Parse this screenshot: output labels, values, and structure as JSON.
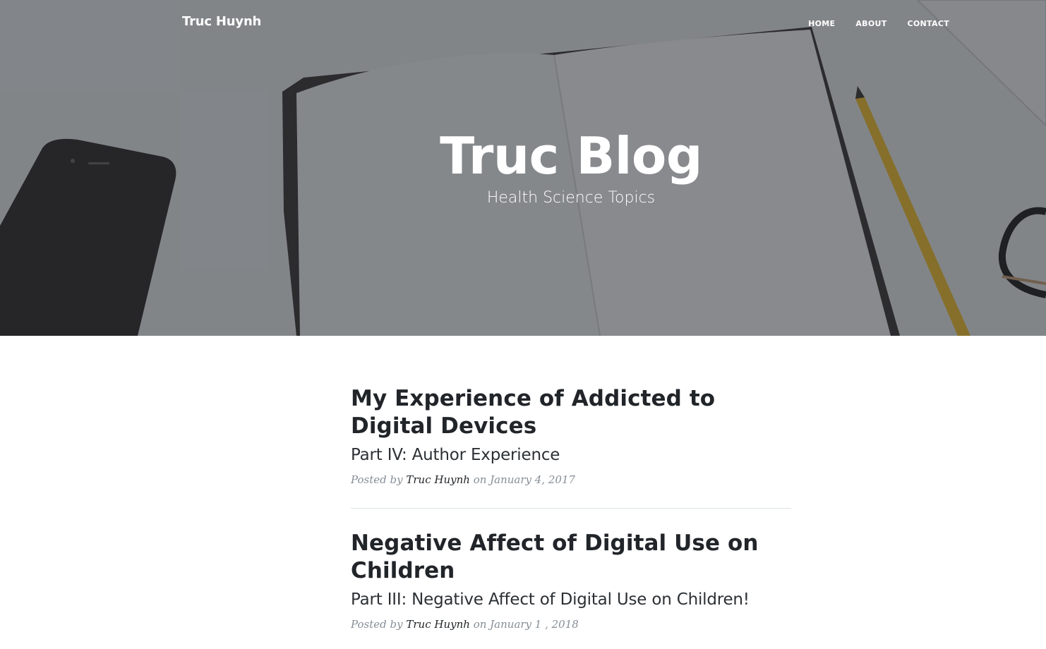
{
  "nav": {
    "brand": "Truc Huynh",
    "links": [
      "HOME",
      "ABOUT",
      "CONTACT"
    ]
  },
  "header": {
    "title": "Truc Blog",
    "subtitle": "Health Science Topics"
  },
  "posts": [
    {
      "title": "My Experience of Addicted to Digital Devices",
      "subtitle": "Part IV: Author Experience",
      "meta_prefix": "Posted by",
      "author": "Truc Huynh",
      "date": "on January 4, 2017"
    },
    {
      "title": "Negative Affect of Digital Use on Children",
      "subtitle": "Part III: Negative Affect of Digital Use on Children!",
      "meta_prefix": "Posted by",
      "author": "Truc Huynh",
      "date": "on January 1 , 2018"
    }
  ],
  "colors": {
    "heading": "#212529",
    "meta": "#868e96",
    "divider": "#dee2e6",
    "hero_overlay": "#212529"
  }
}
